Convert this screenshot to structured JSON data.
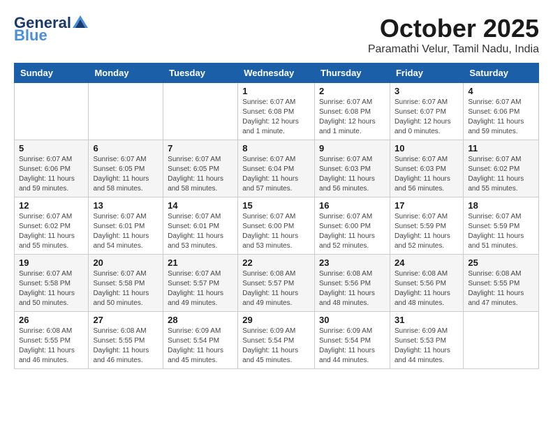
{
  "header": {
    "logo_general": "General",
    "logo_blue": "Blue",
    "month": "October 2025",
    "location": "Paramathi Velur, Tamil Nadu, India"
  },
  "columns": [
    "Sunday",
    "Monday",
    "Tuesday",
    "Wednesday",
    "Thursday",
    "Friday",
    "Saturday"
  ],
  "weeks": [
    [
      {
        "day": "",
        "info": ""
      },
      {
        "day": "",
        "info": ""
      },
      {
        "day": "",
        "info": ""
      },
      {
        "day": "1",
        "info": "Sunrise: 6:07 AM\nSunset: 6:08 PM\nDaylight: 12 hours\nand 1 minute."
      },
      {
        "day": "2",
        "info": "Sunrise: 6:07 AM\nSunset: 6:08 PM\nDaylight: 12 hours\nand 1 minute."
      },
      {
        "day": "3",
        "info": "Sunrise: 6:07 AM\nSunset: 6:07 PM\nDaylight: 12 hours\nand 0 minutes."
      },
      {
        "day": "4",
        "info": "Sunrise: 6:07 AM\nSunset: 6:06 PM\nDaylight: 11 hours\nand 59 minutes."
      }
    ],
    [
      {
        "day": "5",
        "info": "Sunrise: 6:07 AM\nSunset: 6:06 PM\nDaylight: 11 hours\nand 59 minutes."
      },
      {
        "day": "6",
        "info": "Sunrise: 6:07 AM\nSunset: 6:05 PM\nDaylight: 11 hours\nand 58 minutes."
      },
      {
        "day": "7",
        "info": "Sunrise: 6:07 AM\nSunset: 6:05 PM\nDaylight: 11 hours\nand 58 minutes."
      },
      {
        "day": "8",
        "info": "Sunrise: 6:07 AM\nSunset: 6:04 PM\nDaylight: 11 hours\nand 57 minutes."
      },
      {
        "day": "9",
        "info": "Sunrise: 6:07 AM\nSunset: 6:03 PM\nDaylight: 11 hours\nand 56 minutes."
      },
      {
        "day": "10",
        "info": "Sunrise: 6:07 AM\nSunset: 6:03 PM\nDaylight: 11 hours\nand 56 minutes."
      },
      {
        "day": "11",
        "info": "Sunrise: 6:07 AM\nSunset: 6:02 PM\nDaylight: 11 hours\nand 55 minutes."
      }
    ],
    [
      {
        "day": "12",
        "info": "Sunrise: 6:07 AM\nSunset: 6:02 PM\nDaylight: 11 hours\nand 55 minutes."
      },
      {
        "day": "13",
        "info": "Sunrise: 6:07 AM\nSunset: 6:01 PM\nDaylight: 11 hours\nand 54 minutes."
      },
      {
        "day": "14",
        "info": "Sunrise: 6:07 AM\nSunset: 6:01 PM\nDaylight: 11 hours\nand 53 minutes."
      },
      {
        "day": "15",
        "info": "Sunrise: 6:07 AM\nSunset: 6:00 PM\nDaylight: 11 hours\nand 53 minutes."
      },
      {
        "day": "16",
        "info": "Sunrise: 6:07 AM\nSunset: 6:00 PM\nDaylight: 11 hours\nand 52 minutes."
      },
      {
        "day": "17",
        "info": "Sunrise: 6:07 AM\nSunset: 5:59 PM\nDaylight: 11 hours\nand 52 minutes."
      },
      {
        "day": "18",
        "info": "Sunrise: 6:07 AM\nSunset: 5:59 PM\nDaylight: 11 hours\nand 51 minutes."
      }
    ],
    [
      {
        "day": "19",
        "info": "Sunrise: 6:07 AM\nSunset: 5:58 PM\nDaylight: 11 hours\nand 50 minutes."
      },
      {
        "day": "20",
        "info": "Sunrise: 6:07 AM\nSunset: 5:58 PM\nDaylight: 11 hours\nand 50 minutes."
      },
      {
        "day": "21",
        "info": "Sunrise: 6:07 AM\nSunset: 5:57 PM\nDaylight: 11 hours\nand 49 minutes."
      },
      {
        "day": "22",
        "info": "Sunrise: 6:08 AM\nSunset: 5:57 PM\nDaylight: 11 hours\nand 49 minutes."
      },
      {
        "day": "23",
        "info": "Sunrise: 6:08 AM\nSunset: 5:56 PM\nDaylight: 11 hours\nand 48 minutes."
      },
      {
        "day": "24",
        "info": "Sunrise: 6:08 AM\nSunset: 5:56 PM\nDaylight: 11 hours\nand 48 minutes."
      },
      {
        "day": "25",
        "info": "Sunrise: 6:08 AM\nSunset: 5:55 PM\nDaylight: 11 hours\nand 47 minutes."
      }
    ],
    [
      {
        "day": "26",
        "info": "Sunrise: 6:08 AM\nSunset: 5:55 PM\nDaylight: 11 hours\nand 46 minutes."
      },
      {
        "day": "27",
        "info": "Sunrise: 6:08 AM\nSunset: 5:55 PM\nDaylight: 11 hours\nand 46 minutes."
      },
      {
        "day": "28",
        "info": "Sunrise: 6:09 AM\nSunset: 5:54 PM\nDaylight: 11 hours\nand 45 minutes."
      },
      {
        "day": "29",
        "info": "Sunrise: 6:09 AM\nSunset: 5:54 PM\nDaylight: 11 hours\nand 45 minutes."
      },
      {
        "day": "30",
        "info": "Sunrise: 6:09 AM\nSunset: 5:54 PM\nDaylight: 11 hours\nand 44 minutes."
      },
      {
        "day": "31",
        "info": "Sunrise: 6:09 AM\nSunset: 5:53 PM\nDaylight: 11 hours\nand 44 minutes."
      },
      {
        "day": "",
        "info": ""
      }
    ]
  ]
}
